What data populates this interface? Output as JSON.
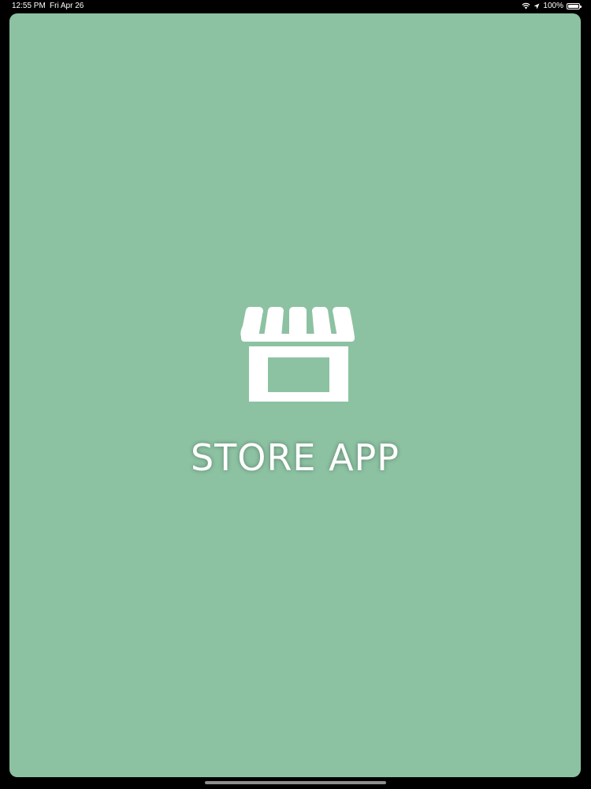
{
  "status_bar": {
    "time": "12:55 PM",
    "date": "Fri Apr 26",
    "battery_percent": "100%",
    "battery_level": 1.0,
    "icons": [
      "wifi-icon",
      "location-icon",
      "battery-icon"
    ]
  },
  "splash": {
    "background_color": "#8cc2a2",
    "icon": "storefront-icon",
    "title": "STORE APP"
  }
}
